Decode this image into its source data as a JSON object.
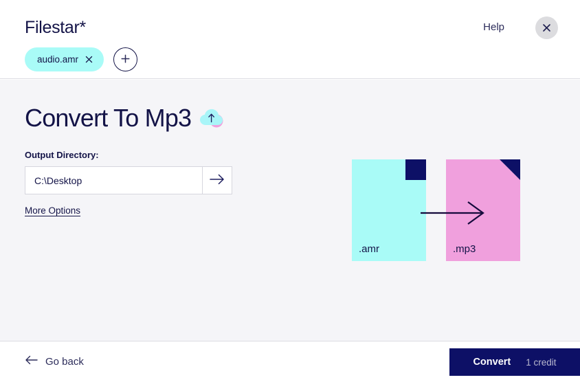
{
  "header": {
    "brand": "Filestar*",
    "help_label": "Help",
    "close_icon": "close-icon",
    "files": [
      {
        "name": "audio.amr",
        "remove_icon": "close-icon"
      }
    ],
    "add_file_label": "+",
    "add_file_icon": "plus-icon"
  },
  "main": {
    "title": "Convert To Mp3",
    "title_icon": "cloud-upload-icon",
    "output_directory_label": "Output Directory:",
    "output_directory_value": "C:\\Desktop",
    "output_directory_placeholder": "C:\\Desktop",
    "directory_go_icon": "arrow-right-icon",
    "more_options_label": "More Options"
  },
  "graphic": {
    "source_extension": ".amr",
    "target_extension": ".mp3",
    "arrow_icon": "arrow-right-icon",
    "source_color": "#a9fbf7",
    "target_color": "#f0a0dd",
    "fold_color": "#0d1066"
  },
  "footer": {
    "back_icon": "arrow-left-icon",
    "back_label": "Go back",
    "convert_label": "Convert",
    "credit_label": "1 credit"
  },
  "colors": {
    "navy": "#131347",
    "button_navy": "#0d1066",
    "cyan": "#a9fbf7",
    "pink": "#f0a0dd",
    "body_bg": "#f5f5f8"
  }
}
